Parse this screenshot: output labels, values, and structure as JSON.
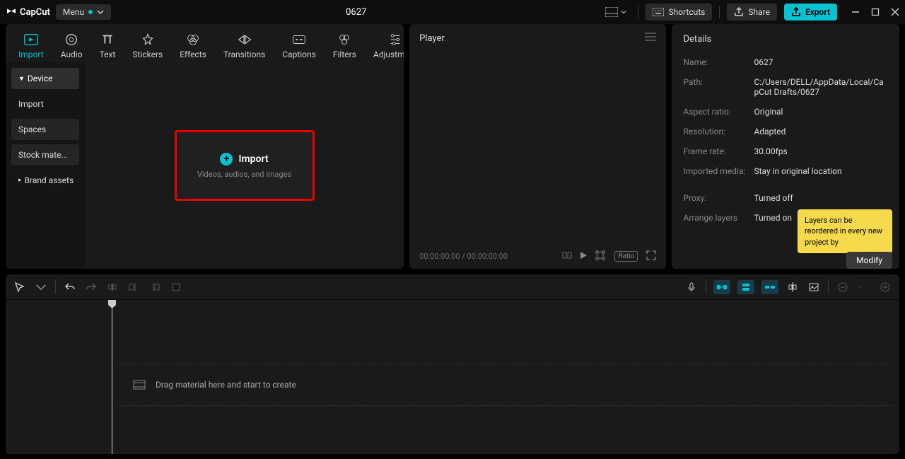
{
  "title": "0627",
  "logo_text": "CapCut",
  "menu_label": "Menu",
  "shortcuts_label": "Shortcuts",
  "share_label": "Share",
  "export_label": "Export",
  "tabs": {
    "import": "Import",
    "audio": "Audio",
    "text": "Text",
    "stickers": "Stickers",
    "effects": "Effects",
    "transitions": "Transitions",
    "captions": "Captions",
    "filters": "Filters",
    "adjustment": "Adjustment"
  },
  "sidebar": {
    "device": "Device",
    "import": "Import",
    "spaces": "Spaces",
    "stock": "Stock mate...",
    "brand": "Brand assets"
  },
  "import_box": {
    "label": "Import",
    "sub": "Videos, audios, and images"
  },
  "player": {
    "header": "Player",
    "time": "00:00:00:00 / 00:00:00:00",
    "ratio": "Ratio"
  },
  "details": {
    "title": "Details",
    "name_label": "Name:",
    "name_value": "0627",
    "path_label": "Path:",
    "path_value": "C:/Users/DELL/AppData/Local/CapCut Drafts/0627",
    "aspect_label": "Aspect ratio:",
    "aspect_value": "Original",
    "resolution_label": "Resolution:",
    "resolution_value": "Adapted",
    "framerate_label": "Frame rate:",
    "framerate_value": "30.00fps",
    "imported_label": "Imported media:",
    "imported_value": "Stay in original location",
    "proxy_label": "Proxy:",
    "proxy_value": "Turned off",
    "layers_label": "Arrange layers",
    "layers_value": "Turned on"
  },
  "tooltip": "Layers can be reordered in every new project by",
  "modify_label": "Modify",
  "timeline_hint": "Drag material here and start to create"
}
